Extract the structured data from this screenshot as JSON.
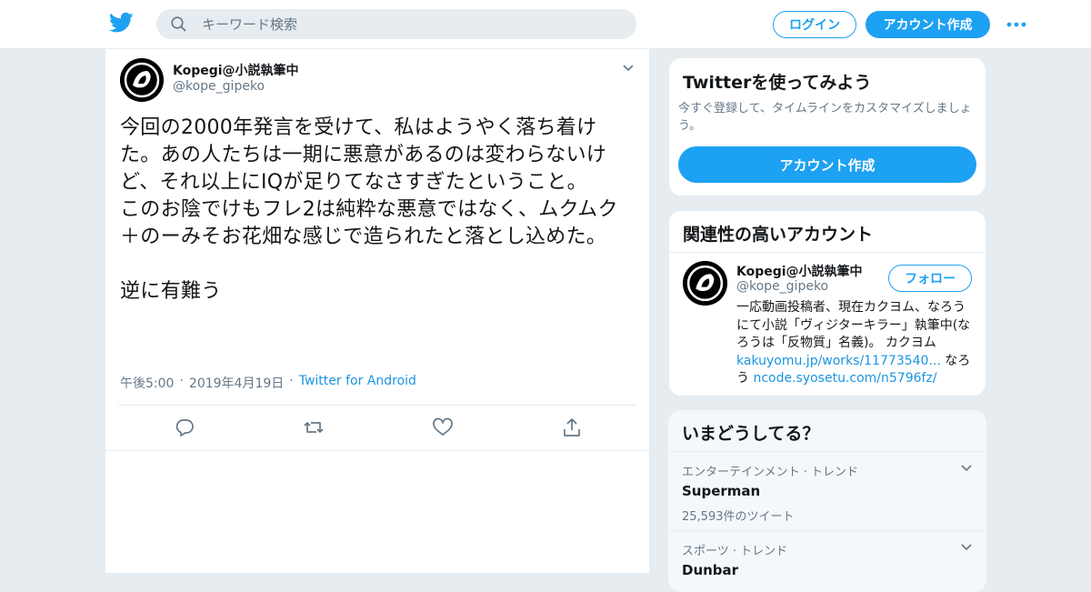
{
  "header": {
    "search_placeholder": "キーワード検索",
    "login_label": "ログイン",
    "signup_label": "アカウント作成"
  },
  "tweet": {
    "author_name": "Kopegi@小説執筆中",
    "author_handle": "@kope_gipeko",
    "text": "今回の2000年発言を受けて、私はようやく落ち着けた。あの人たちは一期に悪意があるのは変わらないけど、それ以上にIQが足りてなさすぎたということ。\nこのお陰でけもフレ2は純粋な悪意ではなく、ムクムク＋のーみそお花畑な感じで造られたと落とし込めた。\n\n逆に有難う",
    "time": "午後5:00",
    "date": "2019年4月19日",
    "source": "Twitter for Android",
    "sep": "·"
  },
  "signup_card": {
    "title": "Twitterを使ってみよう",
    "subtitle": "今すぐ登録して、タイムラインをカスタマイズしましょう。",
    "button_label": "アカウント作成"
  },
  "related_card": {
    "title": "関連性の高いアカウント",
    "name": "Kopegi@小説執筆中",
    "handle": "@kope_gipeko",
    "follow_label": "フォロー",
    "bio_text_1": "一応動画投稿者、現在カクヨム、なろうにて小説「ヴィジターキラー」執筆中(なろうは「反物質」名義)。 カクヨム",
    "bio_link_1": "kakuyomu.jp/works/11773540...",
    "bio_text_2": "なろう",
    "bio_link_2": "ncode.syosetu.com/n5796fz/"
  },
  "trends_card": {
    "title": "いまどうしてる？",
    "items": [
      {
        "context": "エンターテインメント · トレンド",
        "name": "Superman",
        "count": "25,593件のツイート"
      },
      {
        "context": "スポーツ · トレンド",
        "name": "Dunbar",
        "count": ""
      }
    ]
  },
  "colors": {
    "accent": "#1da1f2",
    "link": "#1b95e0",
    "muted": "#657786",
    "background": "#e6ecf0"
  },
  "icons": [
    "twitter-bird-icon",
    "search-icon",
    "more-icon",
    "chevron-down-icon",
    "reply-icon",
    "retweet-icon",
    "like-icon",
    "share-icon"
  ]
}
